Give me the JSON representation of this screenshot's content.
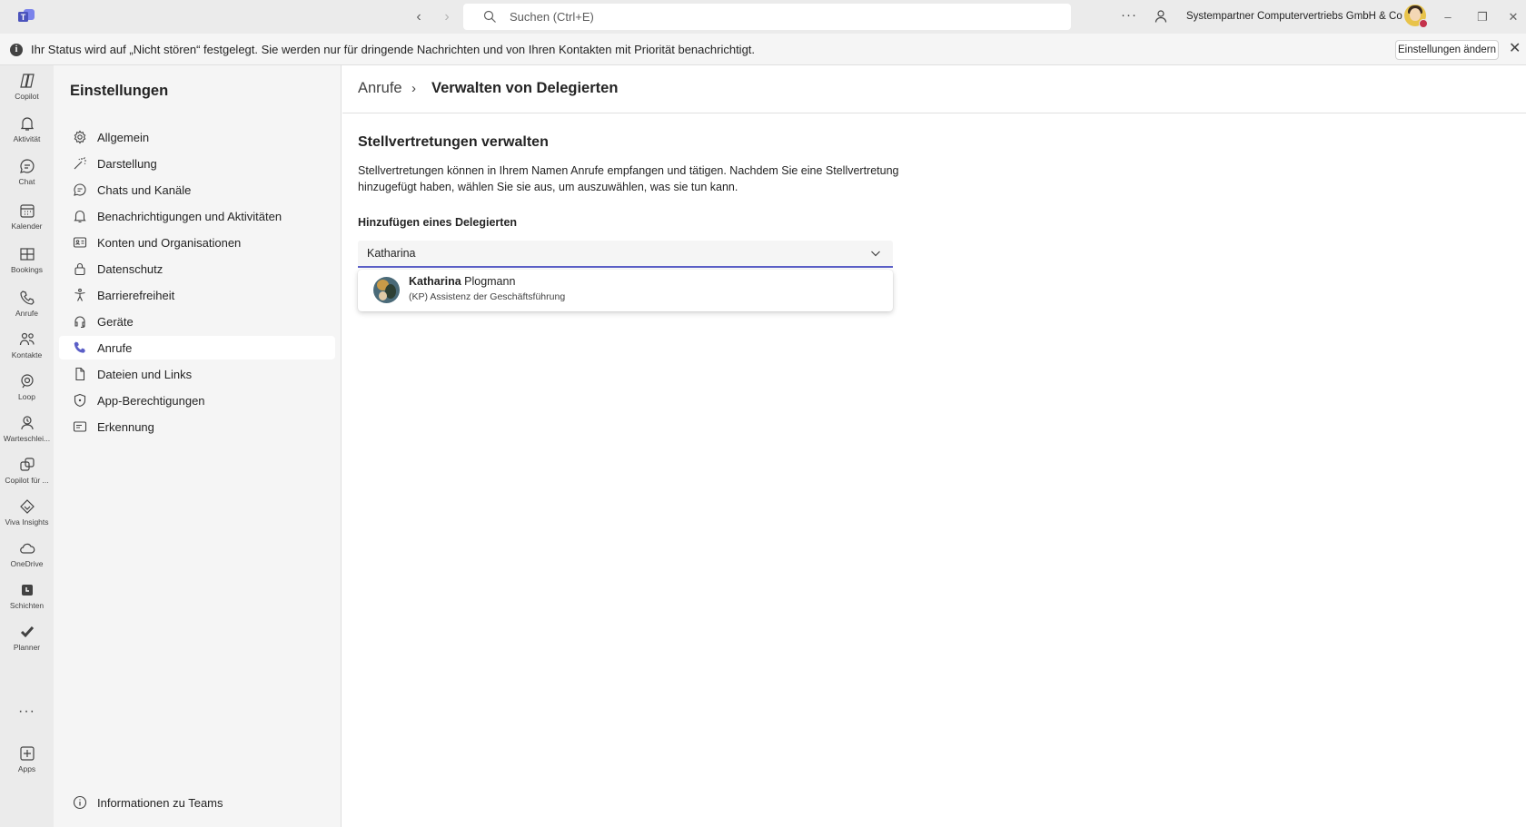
{
  "titlebar": {
    "search_placeholder": "Suchen (Ctrl+E)",
    "more": "···",
    "org_name": "Systempartner Computervertriebs GmbH & Co KG",
    "icons": [
      "teams-logo-icon",
      "back-icon",
      "forward-icon",
      "search-icon",
      "more-icon",
      "people-icon",
      "minimize-icon",
      "maximize-icon",
      "close-icon"
    ]
  },
  "banner": {
    "message": "Ihr Status wird auf „Nicht stören“ festgelegt. Sie werden nur für dringende Nachrichten und von Ihren Kontakten mit Priorität benachrichtigt.",
    "button": "Einstellungen ändern"
  },
  "rail": {
    "items": [
      {
        "label": "Copilot",
        "icon": "copilot-icon"
      },
      {
        "label": "Aktivität",
        "icon": "bell-icon"
      },
      {
        "label": "Chat",
        "icon": "chat-icon"
      },
      {
        "label": "Kalender",
        "icon": "calendar-icon"
      },
      {
        "label": "Bookings",
        "icon": "bookings-icon"
      },
      {
        "label": "Anrufe",
        "icon": "phone-icon"
      },
      {
        "label": "Kontakte",
        "icon": "contacts-icon"
      },
      {
        "label": "Loop",
        "icon": "loop-icon"
      },
      {
        "label": "Warteschlei...",
        "icon": "queue-icon"
      },
      {
        "label": "Copilot für ...",
        "icon": "copilot-studio-icon"
      },
      {
        "label": "Viva Insights",
        "icon": "viva-insights-icon"
      },
      {
        "label": "OneDrive",
        "icon": "cloud-icon"
      },
      {
        "label": "Schichten",
        "icon": "shifts-icon"
      },
      {
        "label": "Planner",
        "icon": "planner-icon"
      }
    ],
    "more": "···",
    "apps_label": "Apps"
  },
  "settings": {
    "title": "Einstellungen",
    "items": [
      {
        "label": "Allgemein",
        "icon": "gear-icon"
      },
      {
        "label": "Darstellung",
        "icon": "wand-icon"
      },
      {
        "label": "Chats und Kanäle",
        "icon": "chat-bubble-icon"
      },
      {
        "label": "Benachrichtigungen und Aktivitäten",
        "icon": "bell-icon"
      },
      {
        "label": "Konten und Organisationen",
        "icon": "id-card-icon"
      },
      {
        "label": "Datenschutz",
        "icon": "lock-icon"
      },
      {
        "label": "Barrierefreiheit",
        "icon": "accessibility-icon"
      },
      {
        "label": "Geräte",
        "icon": "headset-icon"
      },
      {
        "label": "Anrufe",
        "icon": "phone-icon",
        "active": true
      },
      {
        "label": "Dateien und Links",
        "icon": "document-icon"
      },
      {
        "label": "App-Berechtigungen",
        "icon": "shield-icon"
      },
      {
        "label": "Erkennung",
        "icon": "recognition-icon"
      }
    ],
    "about": "Informationen zu Teams"
  },
  "main": {
    "breadcrumb_parent": "Anrufe",
    "breadcrumb_sep": "›",
    "breadcrumb_current": "Verwalten von Delegierten",
    "section_title": "Stellvertretungen verwalten",
    "section_desc": "Stellvertretungen können in Ihrem Namen Anrufe empfangen und tätigen. Nachdem Sie eine Stellvertretung hinzugefügt haben, wählen Sie sie aus, um auszuwählen, was sie tun kann.",
    "add_label": "Hinzufügen eines Delegierten",
    "input_value": "Katharina",
    "suggestion": {
      "name_match": "Katharina",
      "name_rest": " Plogmann",
      "subtitle": "(KP) Assistenz der Geschäftsführung"
    }
  },
  "colors": {
    "accent": "#5b5fc7",
    "dnd": "#c4314b",
    "rail_bg": "#ebebeb",
    "sidebar_bg": "#f5f5f5"
  }
}
